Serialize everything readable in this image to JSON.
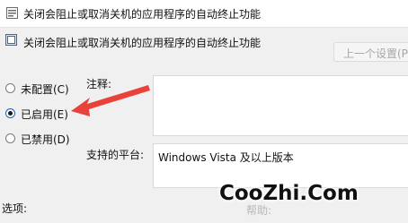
{
  "window": {
    "title": "关闭会阻止或取消关机的应用程序的自动终止功能"
  },
  "header": {
    "title": "关闭会阻止或取消关机的应用程序的自动终止功能",
    "prev_button_label": "上一个设置(P)"
  },
  "state_options": [
    {
      "label": "未配置(C)",
      "checked": false
    },
    {
      "label": "已启用(E)",
      "checked": true
    },
    {
      "label": "已禁用(D)",
      "checked": false
    }
  ],
  "comment": {
    "label": "注释:",
    "value": ""
  },
  "supported_on": {
    "label": "支持的平台:",
    "value": "Windows Vista 及以上版本"
  },
  "options": {
    "label": "选项:"
  },
  "help": {
    "label_fragment": "帮助:"
  },
  "watermark": "CooZhi.Com",
  "colors": {
    "arrow": "#e8423a",
    "radio_checked": "#1a5fb4"
  }
}
